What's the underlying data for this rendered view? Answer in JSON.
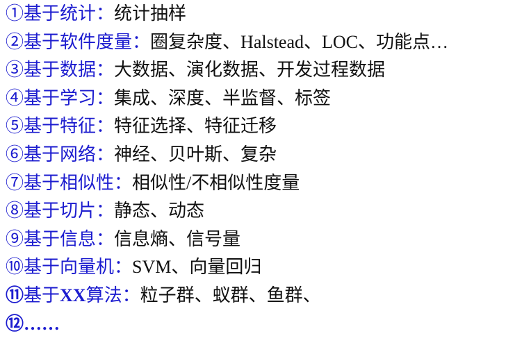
{
  "items": [
    {
      "marker": "①",
      "label": "基于统计",
      "sep": "：",
      "desc": "统计抽样"
    },
    {
      "marker": "②",
      "label": "基于软件度量",
      "sep": "：",
      "desc": "圈复杂度、Halstead、LOC、功能点…"
    },
    {
      "marker": "③",
      "label": "基于数据",
      "sep": "：",
      "desc": "大数据、演化数据、开发过程数据"
    },
    {
      "marker": "④",
      "label": "基于学习",
      "sep": "：",
      "desc": "集成、深度、半监督、标签"
    },
    {
      "marker": "⑤",
      "label": "基于特征",
      "sep": "：",
      "desc": "特征选择、特征迁移"
    },
    {
      "marker": "⑥",
      "label": "基于网络",
      "sep": "：",
      "desc": "神经、贝叶斯、复杂"
    },
    {
      "marker": "⑦",
      "label": "基于相似性",
      "sep": "：",
      "desc": "相似性/不相似性度量"
    },
    {
      "marker": "⑧",
      "label": "基于切片",
      "sep": "：",
      "desc": "静态、动态"
    },
    {
      "marker": "⑨",
      "label": "基于信息",
      "sep": "：",
      "desc": "信息熵、信号量"
    },
    {
      "marker": "⑩",
      "label": "基于向量机",
      "sep": "：",
      "desc": "SVM、向量回归"
    },
    {
      "marker": "⑪",
      "label": "基于XX算法",
      "sep": "：",
      "desc": "粒子群、蚁群、鱼群、"
    },
    {
      "marker": "⑫",
      "label": "……",
      "sep": "",
      "desc": ""
    }
  ]
}
